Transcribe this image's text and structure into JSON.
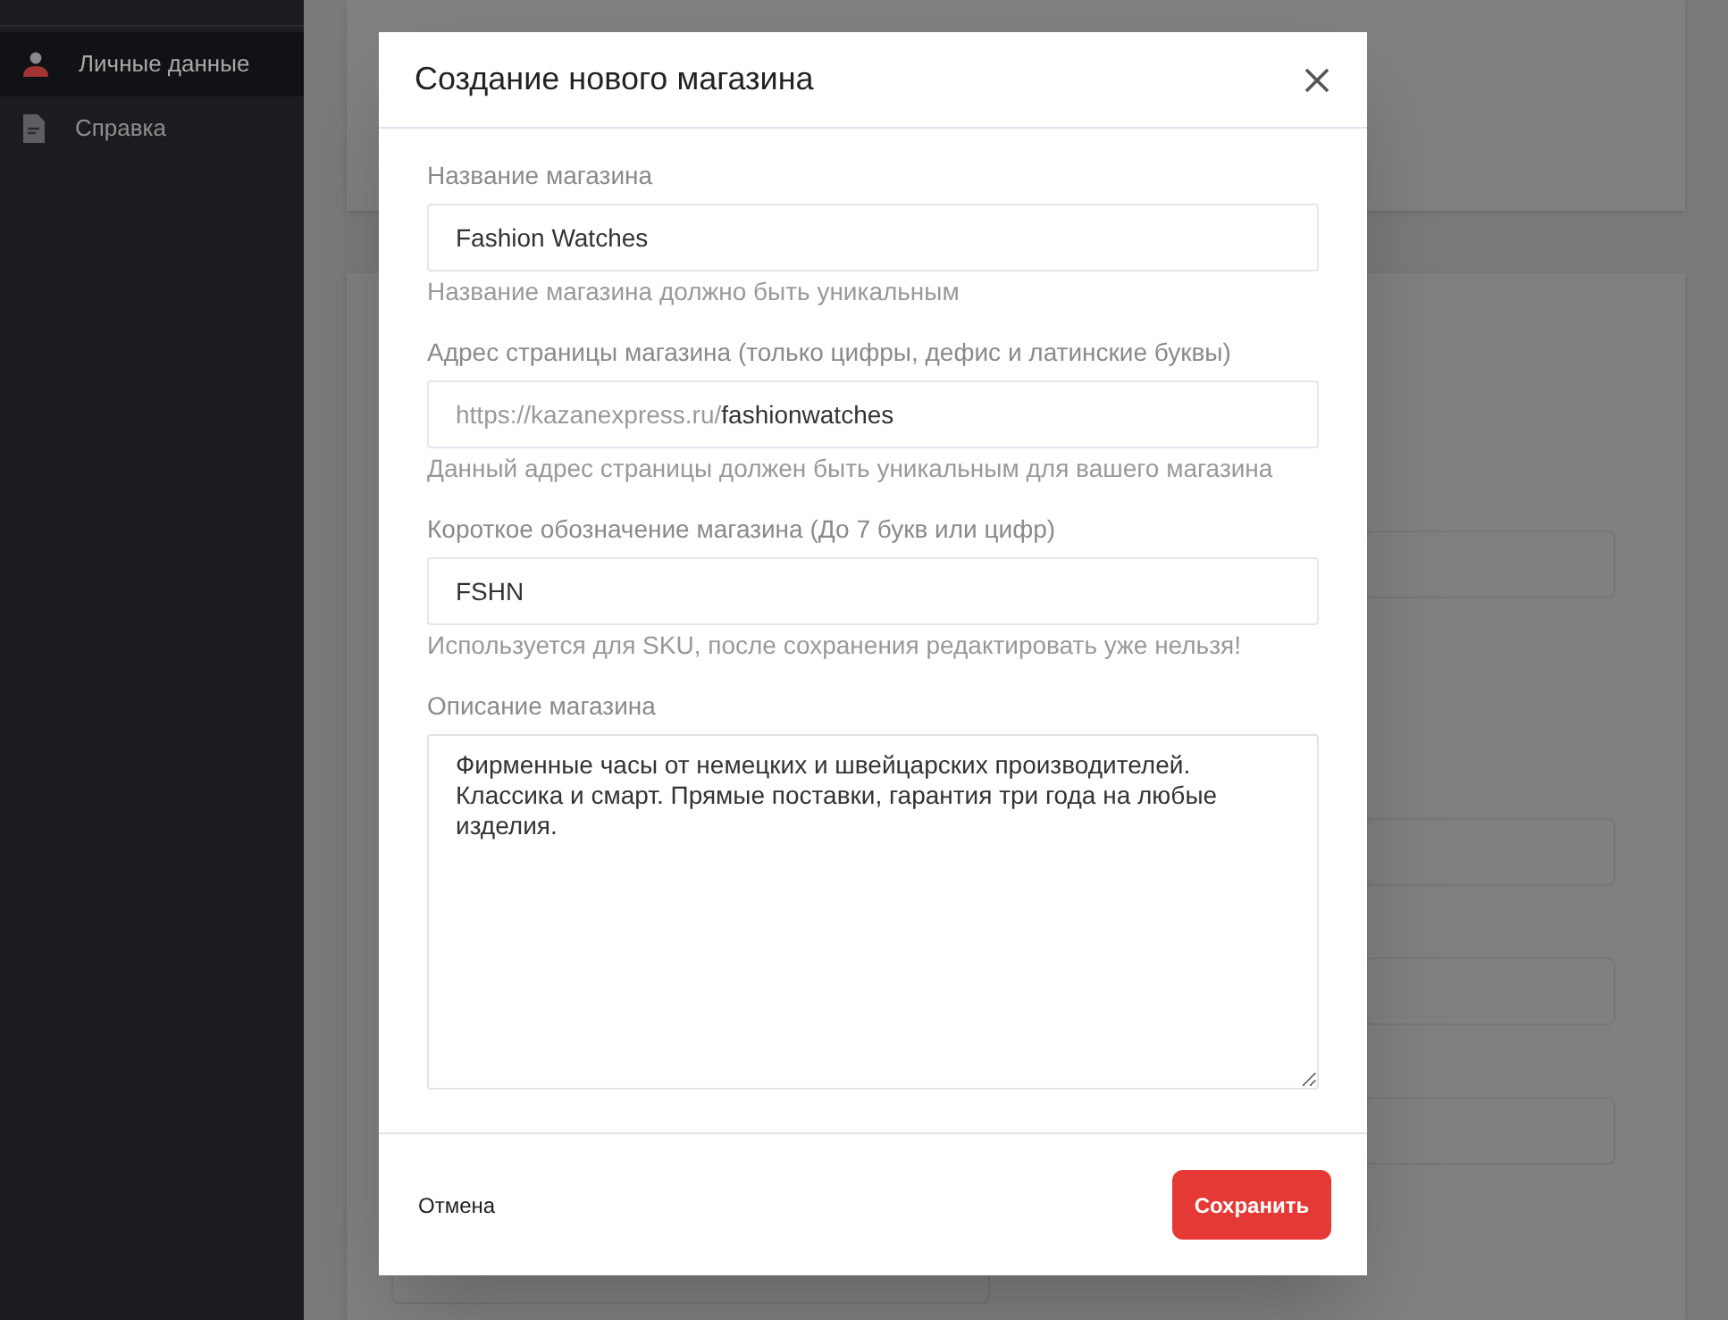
{
  "sidebar": {
    "items": [
      {
        "label": "Личные данные",
        "kind": "person",
        "selected": true
      },
      {
        "label": "Справка",
        "kind": "document",
        "selected": false
      }
    ]
  },
  "dialog": {
    "title": "Создание нового магазина",
    "fields": [
      {
        "kind": "text",
        "label": "Название магазина",
        "value": "Fashion Watches",
        "hint": "Название магазина должно быть уникальным"
      },
      {
        "kind": "url",
        "label": "Адрес страницы магазина (только цифры, дефис и латинские буквы)",
        "prefix": "https://kazanexpress.ru/",
        "value": "fashionwatches",
        "hint": "Данный адрес страницы должен быть уникальным для вашего магазина"
      },
      {
        "kind": "text",
        "label": "Короткое обозначение магазина (До 7 букв или цифр)",
        "value": "FSHN",
        "hint": "Используется для SKU, после сохранения редактировать уже нельзя!"
      },
      {
        "kind": "textarea",
        "label": "Описание магазина",
        "value": "Фирменные часы от немецких и швейцарских производителей. Классика и смарт. Прямые поставки, гарантия три года на любые изделия."
      }
    ],
    "buttons": [
      {
        "kind": "secondary",
        "label": "Отмена"
      },
      {
        "kind": "primary",
        "label": "Сохранить"
      }
    ]
  }
}
